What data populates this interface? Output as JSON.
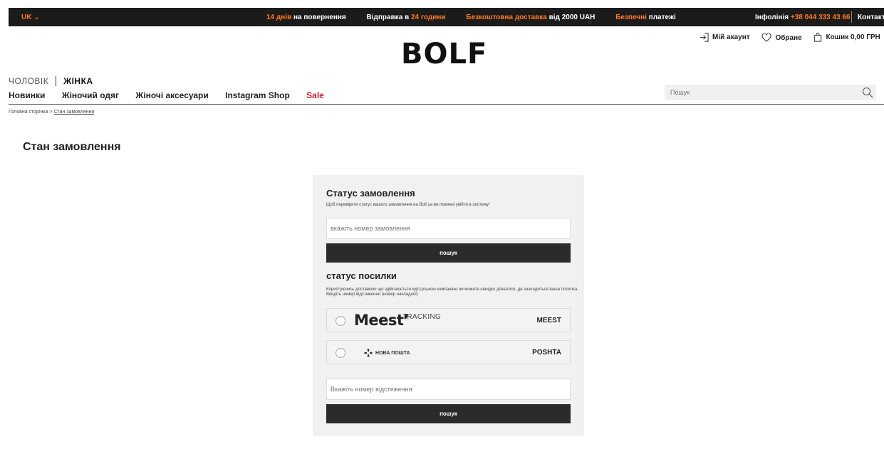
{
  "topbar": {
    "lang": "UK ⌄",
    "promos": [
      {
        "accent": "14 днів",
        "rest": " на повернення"
      },
      {
        "pre": "Відправка в ",
        "accent": "24 години"
      },
      {
        "accent": "Безкоштовна доставка",
        "rest": " від 2000 UAH"
      },
      {
        "accent": "Безпечні",
        "rest": " платежі"
      }
    ],
    "hotline_label": "Інфолінія ",
    "hotline_number": "+38 044 333 43 66",
    "contact": "Контакт"
  },
  "header": {
    "logo": "BOLF",
    "account": "Мій акаунт",
    "favorites": "Обране",
    "cart": "Кошик 0,00 ГРН"
  },
  "gender": {
    "man": "ЧОЛОВІК",
    "woman": "ЖІНКА"
  },
  "nav": {
    "items": [
      "Новинки",
      "Жіночий одяг",
      "Жіночі аксесуари",
      "Instagram Shop"
    ],
    "sale": "Sale"
  },
  "search": {
    "placeholder": "Пошук"
  },
  "breadcrumb": {
    "home": "Головна сторінка",
    "separator": ">",
    "current": "Стан замовлення"
  },
  "page_title": "Стан замовлення",
  "order_status": {
    "title": "Статус замовлення",
    "hint": "Щоб перевірити статус вашого замовлення на Bolf.ua ви повинні увійти в систему!",
    "placeholder": "вкажіть номер замовлення",
    "button": "пошук"
  },
  "parcel_status": {
    "title": "статус посилки",
    "hint": "Користуючись доставкою що здійснюється кур'єрською компанією ви можете швидко дізнатися, де знаходиться ваша посилка. Введіть номер відстеження (номер накладної)",
    "carriers": [
      {
        "logo": "Meest",
        "tagline": "TRACKING",
        "code": "MEEST"
      },
      {
        "logo": "НОВА ПОШТА",
        "code": "POSHTA"
      }
    ],
    "placeholder": "Вкажіть номер відстеження",
    "button": "пошук"
  },
  "colors": {
    "accent": "#ff7a1a",
    "sale": "#e0202a",
    "topbar": "#1b1b1b",
    "button": "#2b2b2b"
  }
}
